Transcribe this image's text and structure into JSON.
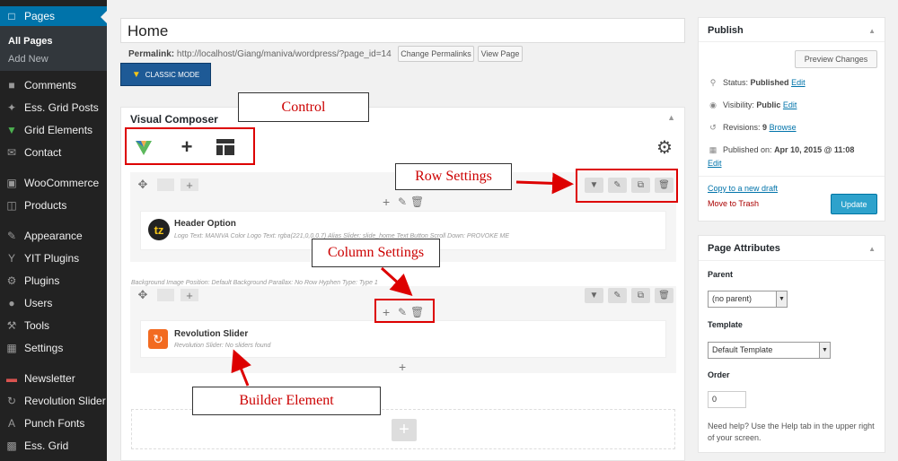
{
  "sidebar": {
    "pages": "Pages",
    "sub_all_pages": "All Pages",
    "sub_add_new": "Add New",
    "items": [
      {
        "label": "Comments",
        "icon": "comments-icon"
      },
      {
        "label": "Ess. Grid Posts",
        "icon": "pin-icon"
      },
      {
        "label": "Grid Elements",
        "icon": "vc-logo-icon"
      },
      {
        "label": "Contact",
        "icon": "mail-icon"
      },
      {
        "label": "WooCommerce",
        "icon": "woo-icon"
      },
      {
        "label": "Products",
        "icon": "cart-icon"
      },
      {
        "label": "Appearance",
        "icon": "brush-icon"
      },
      {
        "label": "YIT Plugins",
        "icon": "yit-icon"
      },
      {
        "label": "Plugins",
        "icon": "plugin-icon"
      },
      {
        "label": "Users",
        "icon": "user-icon"
      },
      {
        "label": "Tools",
        "icon": "wrench-icon"
      },
      {
        "label": "Settings",
        "icon": "settings-icon"
      },
      {
        "label": "Newsletter",
        "icon": "newsletter-icon"
      },
      {
        "label": "Revolution Slider",
        "icon": "refresh-icon"
      },
      {
        "label": "Punch Fonts",
        "icon": "font-icon"
      },
      {
        "label": "Ess. Grid",
        "icon": "grid-icon"
      }
    ]
  },
  "editor": {
    "title": "Home",
    "permalink_label": "Permalink:",
    "permalink_url": "http://localhost/Giang/maniva/wordpress/?page_id=14",
    "change_permalinks": "Change Permalinks",
    "view_page": "View Page",
    "classic_mode": "CLASSIC MODE"
  },
  "vc": {
    "title": "Visual Composer",
    "row1": {
      "element_title": "Header Option",
      "element_desc": "Logo Text: MANIVA  Color Logo Text: rgba(221,0,0,0.7)  Alias Slider: slide_home  Text Button Scroll Down: PROVOKE ME"
    },
    "row2_info": "Background Image Position: Default  Background Parallax: No  Row Hyphen Type: Type 1",
    "row2": {
      "element_title": "Revolution Slider",
      "element_desc": "Revolution Slider: No sliders found"
    },
    "add_plus": "+"
  },
  "annotations": {
    "control": "Control",
    "row_settings": "Row Settings",
    "column_settings": "Column Settings",
    "builder_element": "Builder Element"
  },
  "publish": {
    "title": "Publish",
    "preview": "Preview Changes",
    "status_label": "Status:",
    "status_value": "Published",
    "visibility_label": "Visibility:",
    "visibility_value": "Public",
    "revisions_label": "Revisions:",
    "revisions_value": "9",
    "browse": "Browse",
    "published_on_label": "Published on:",
    "published_on_value": "Apr 10, 2015 @ 11:08",
    "edit": "Edit",
    "copy_draft": "Copy to a new draft",
    "trash": "Move to Trash",
    "update": "Update"
  },
  "page_attributes": {
    "title": "Page Attributes",
    "parent_label": "Parent",
    "parent_value": "(no parent)",
    "template_label": "Template",
    "template_value": "Default Template",
    "order_label": "Order",
    "order_value": "0",
    "help": "Need help? Use the Help tab in the upper right of your screen."
  },
  "colors": {
    "admin_bg": "#222222",
    "active_blue": "#0073aa",
    "update_blue": "#2ea2cc",
    "annotation_red": "#cc0000"
  }
}
